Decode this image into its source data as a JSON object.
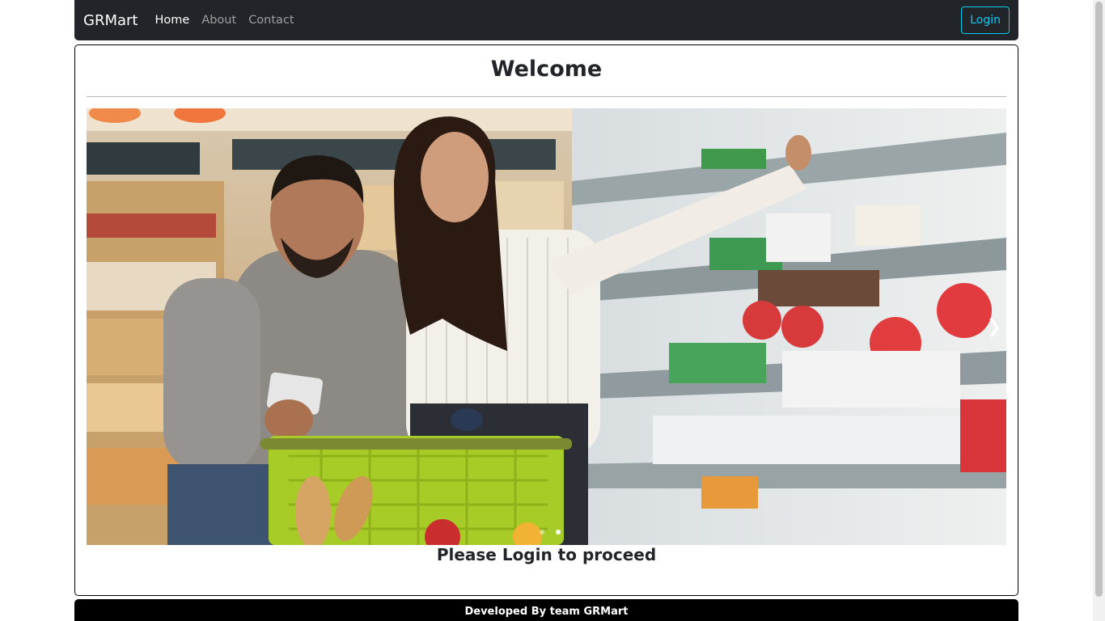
{
  "navbar": {
    "brand": "GRMart",
    "links": [
      {
        "label": "Home",
        "active": true
      },
      {
        "label": "About",
        "active": false
      },
      {
        "label": "Contact",
        "active": false
      }
    ],
    "login_label": "Login"
  },
  "main": {
    "title": "Welcome",
    "carousel": {
      "image": "shopping-couple-supermarket-photo",
      "next_icon": "chevron-right-icon",
      "slide_count": 2,
      "active_slide": 2
    },
    "prompt": "Please Login to proceed"
  },
  "footer": {
    "text": "Developed By team GRMart"
  },
  "colors": {
    "navbar_bg": "#212529",
    "login_accent": "#0dcaf0",
    "footer_bg": "#000000"
  }
}
